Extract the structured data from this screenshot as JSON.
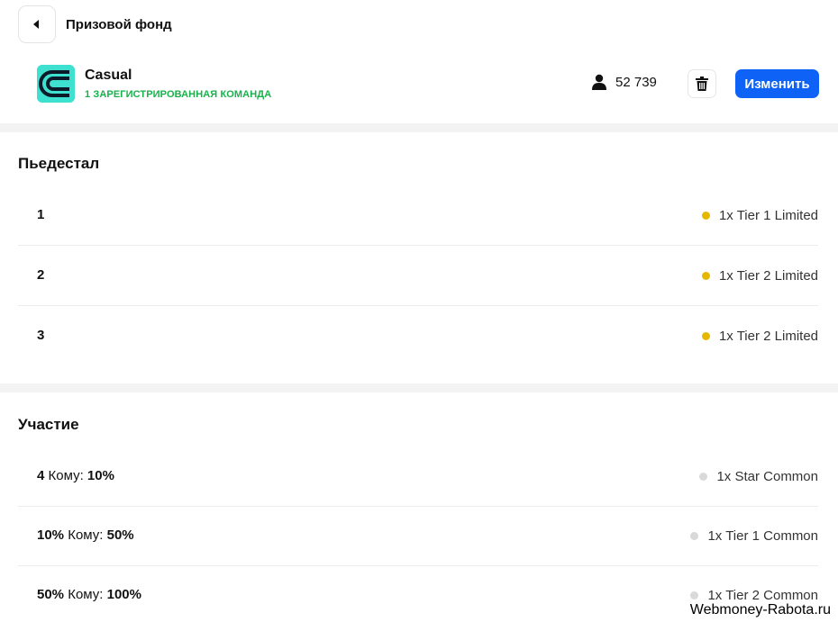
{
  "header": {
    "title": "Призовой фонд"
  },
  "league": {
    "name": "Casual",
    "teams_label": "1 ЗАРЕГИСТРИРОВАННАЯ КОМАНДА",
    "players_count": "52 739",
    "edit_label": "Изменить"
  },
  "podium": {
    "title": "Пьедестал",
    "rows": [
      {
        "rank": "1",
        "prize": "1x Tier 1 Limited"
      },
      {
        "rank": "2",
        "prize": "1x Tier 2 Limited"
      },
      {
        "rank": "3",
        "prize": "1x Tier 2 Limited"
      }
    ]
  },
  "participation": {
    "title": "Участие",
    "to_label": "Кому:",
    "rows": [
      {
        "from": "4",
        "to": "10%",
        "prize": "1x Star Common"
      },
      {
        "from": "10%",
        "to": "50%",
        "prize": "1x Tier 1 Common"
      },
      {
        "from": "50%",
        "to": "100%",
        "prize": "1x Tier 2 Common"
      }
    ]
  },
  "colors": {
    "accent": "#0e63f6",
    "teams_green": "#17b24a",
    "limited_dot": "#e5b800",
    "common_dot": "#d9d9d9",
    "logo_bg": "#3ee0cf"
  },
  "watermark": "Webmoney-Rabota.ru"
}
